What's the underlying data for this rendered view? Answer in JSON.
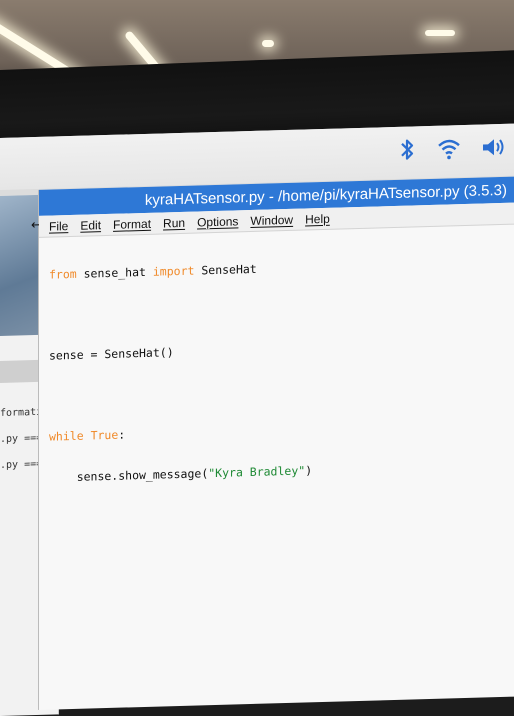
{
  "window": {
    "title": "kyraHATsensor.py - /home/pi/kyraHATsensor.py (3.5.3)"
  },
  "menubar": {
    "items": [
      "File",
      "Edit",
      "Format",
      "Run",
      "Options",
      "Window",
      "Help"
    ]
  },
  "tray": {
    "icons": [
      "bluetooth-icon",
      "wifi-icon",
      "volume-icon"
    ]
  },
  "code": {
    "lines": [
      {
        "kw1": "from",
        "t1": " sense_hat ",
        "kw2": "import",
        "t2": " SenseHat"
      },
      {
        "t1": ""
      },
      {
        "t1": "sense = SenseHat()"
      },
      {
        "t1": ""
      },
      {
        "kw1": "while",
        "t1": " ",
        "kw2": "True",
        "t2": ":"
      },
      {
        "t1": "    sense.show_message(",
        "str": "\"Kyra Bradley\"",
        "t2": ")"
      }
    ]
  },
  "background_window": {
    "lines": [
      "formation",
      ".py =====",
      ".py ====="
    ]
  },
  "colors": {
    "titlebar": "#2e78d6",
    "keyword": "#f08a2a",
    "string": "#1f8a35"
  }
}
